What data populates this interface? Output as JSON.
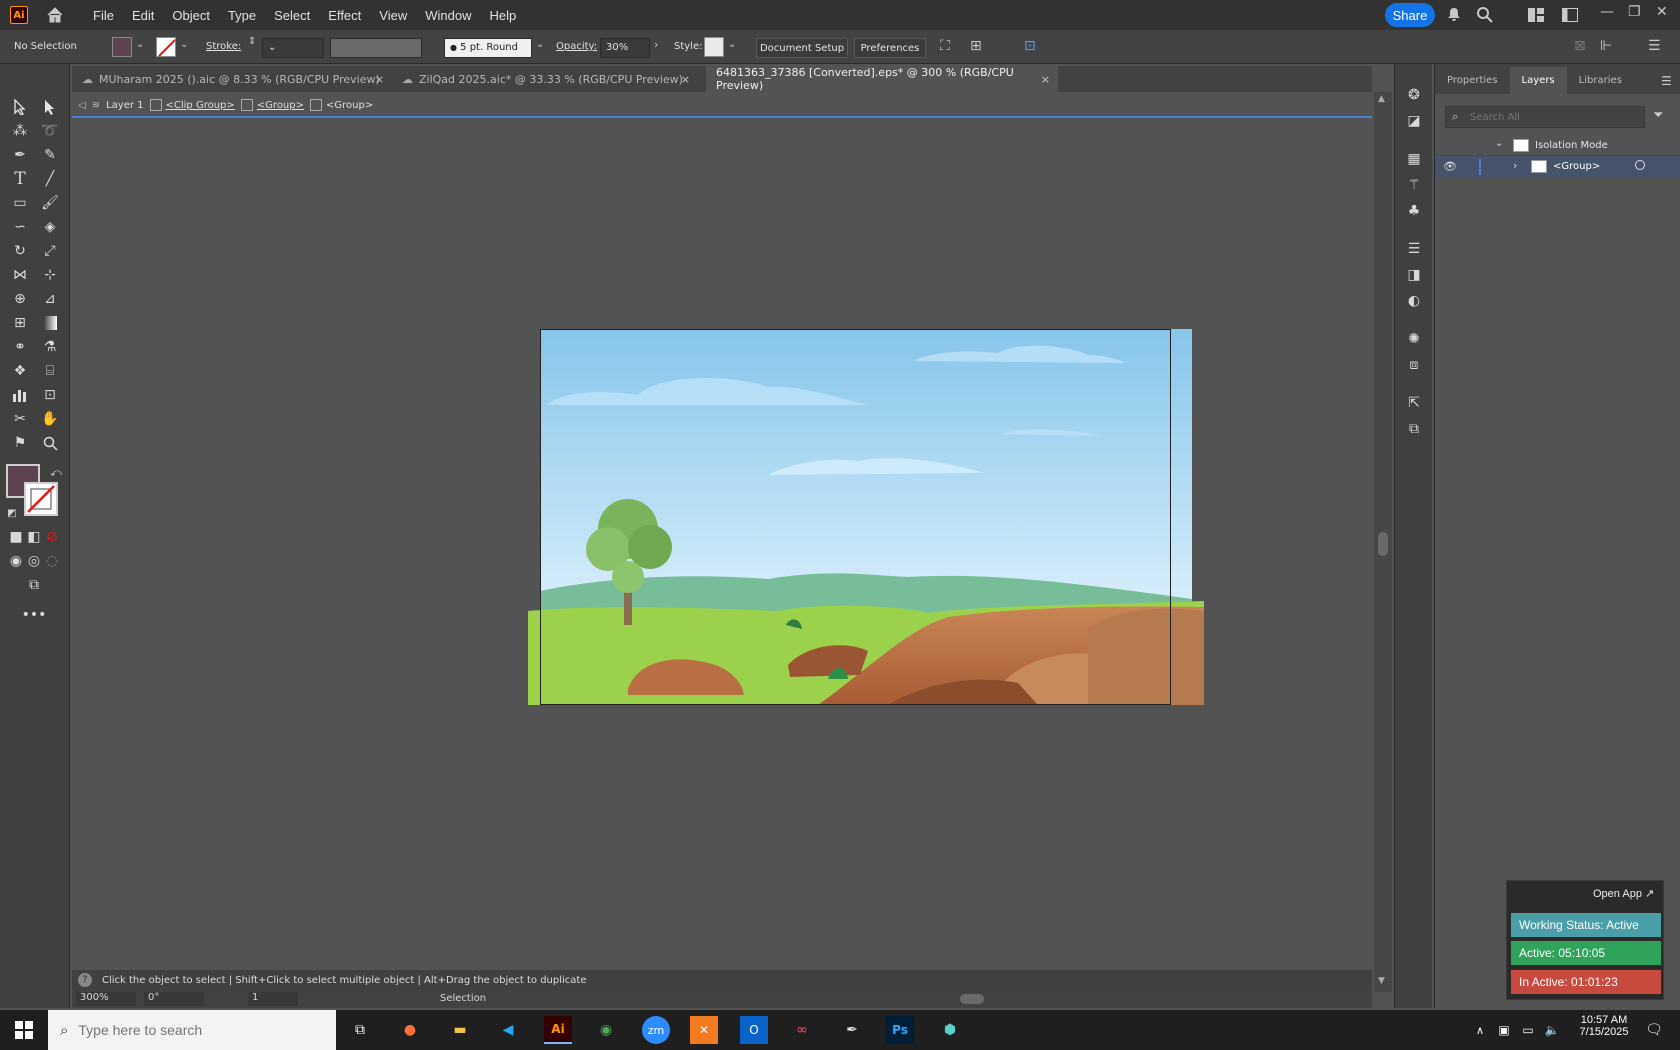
{
  "menubar": {
    "app_logo": "Ai",
    "menus": [
      "File",
      "Edit",
      "Object",
      "Type",
      "Select",
      "Effect",
      "View",
      "Window",
      "Help"
    ],
    "share_label": "Share"
  },
  "controlbar": {
    "selection": "No Selection",
    "stroke_label": "Stroke:",
    "brush": "5 pt. Round",
    "opacity_label": "Opacity:",
    "opacity_value": "30%",
    "style_label": "Style:",
    "document_setup": "Document Setup",
    "preferences": "Preferences"
  },
  "tabs": [
    {
      "label": "MUharam 2025 ().aic @ 8.33 % (RGB/CPU Preview)"
    },
    {
      "label": "ZilQad 2025.aic* @ 33.33 % (RGB/CPU Preview)"
    },
    {
      "label": "6481363_37386 [Converted].eps* @ 300 % (RGB/CPU Preview)"
    }
  ],
  "tab_close": "×",
  "breadcrumb": {
    "layer": "Layer 1",
    "clip_group": "<Clip Group>",
    "group1": "<Group>",
    "group2": "<Group>"
  },
  "panel": {
    "tabs": [
      "Properties",
      "Layers",
      "Libraries"
    ],
    "search_placeholder": "Search All",
    "isolation_mode": "Isolation Mode",
    "group_row": "<Group>"
  },
  "statusbar": {
    "hint": "Click the object to select  |  Shift+Click to select multiple object  |  Alt+Drag the object to duplicate",
    "zoom": "300%",
    "rotation": "0°",
    "artboard": "1",
    "tool": "Selection"
  },
  "workwidget": {
    "open_app": "Open App ↗",
    "status": "Working Status: Active",
    "active": "Active: 05:10:05",
    "inactive": "In Active: 01:01:23"
  },
  "taskbar": {
    "search_placeholder": "Type here to search",
    "time": "10:57 AM",
    "date": "7/15/2025"
  },
  "colors": {
    "accent": "#1473e6",
    "status_teal": "#4a9ea8",
    "status_green": "#2fa35a",
    "status_red": "#c8493d",
    "fill_swatch": "#5e4450"
  }
}
